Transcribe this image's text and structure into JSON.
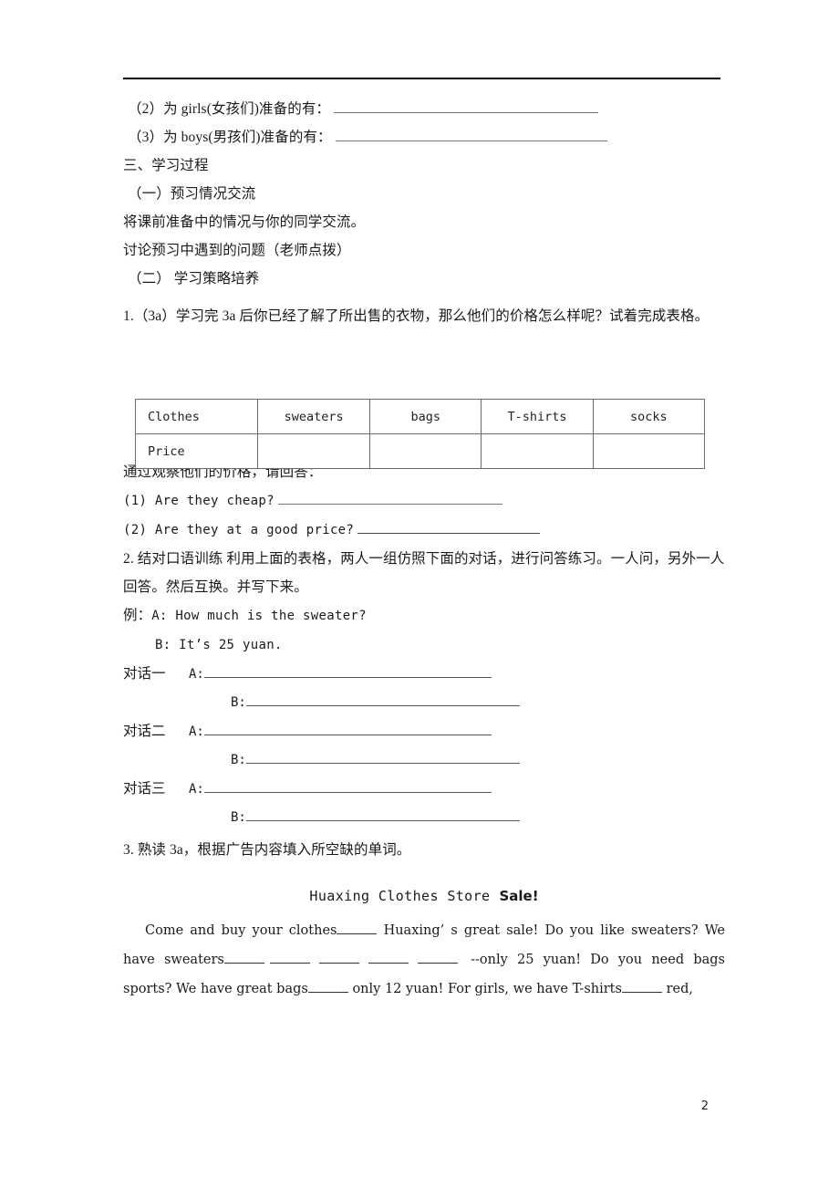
{
  "document": {
    "page_number": "2",
    "header_rule": true
  },
  "questions_top": [
    {
      "number": "（2）",
      "text": "为 girls(女孩们)准备的有：",
      "blank_width": 290
    },
    {
      "number": "（3）",
      "text": "为 boys(男孩们)准备的有：",
      "blank_width": 298
    }
  ],
  "sections": {
    "part_three_heading": "三、学习过程",
    "sub_one_heading": "（一）预习情况交流",
    "sub_one_line1": "将课前准备中的情况与你的同学交流。",
    "sub_one_line2": "讨论预习中遇到的问题（老师点拨）",
    "sub_two_heading": "（二） 学习策略培养",
    "task1_text": "1.（3a）学习完 3a 后你已经了解了所出售的衣物，那么他们的价格怎么样呢？试着完成表格。"
  },
  "price_table": {
    "rows": [
      [
        "Clothes",
        "sweaters",
        "bags",
        "T-shirts",
        "socks"
      ],
      [
        "Price",
        "",
        "",
        "",
        ""
      ]
    ]
  },
  "observe": {
    "prompt": "通过观察他们的价格，请回答：",
    "q1": "(1) Are they cheap?",
    "q1_blank_width": 246,
    "q2": "(2) Are they at a good price?",
    "q2_blank_width": 200
  },
  "task2": {
    "text": "2. 结对口语训练 利用上面的表格，两人一组仿照下面的对话，进行问答练习。一人问，另外一人回答。然后互换。并写下来。",
    "example_label": "例：",
    "example_a": "A: How much is the sweater?",
    "example_b": "B: It’s 25 yuan.",
    "dialogues": [
      {
        "tag": "对话一",
        "a_speaker": "A:",
        "b_speaker": "B:",
        "a_width": 315,
        "b_width": 300
      },
      {
        "tag": "对话二",
        "a_speaker": "A:",
        "b_speaker": "B:",
        "a_width": 315,
        "b_width": 300
      },
      {
        "tag": "对话三",
        "a_speaker": "A:",
        "b_speaker": "B:",
        "a_width": 315,
        "b_width": 300
      }
    ]
  },
  "task3": {
    "text": "3. 熟读 3a，根据广告内容填入所空缺的单词。",
    "advert": {
      "store_name": "Huaxing Clothes Store",
      "sale_label": "Sale!",
      "line1_a": "Come and buy your clothes",
      "line1_b": "Huaxing’ s great sale! Do you like sweaters? We",
      "line2_a": "have sweaters",
      "line2_b": "--only 25 yuan! Do you need bags",
      "line3_a": "sports? We have great bags",
      "line3_b": "only 12 yuan! For girls, we have T-shirts",
      "line3_c": "red,"
    }
  }
}
